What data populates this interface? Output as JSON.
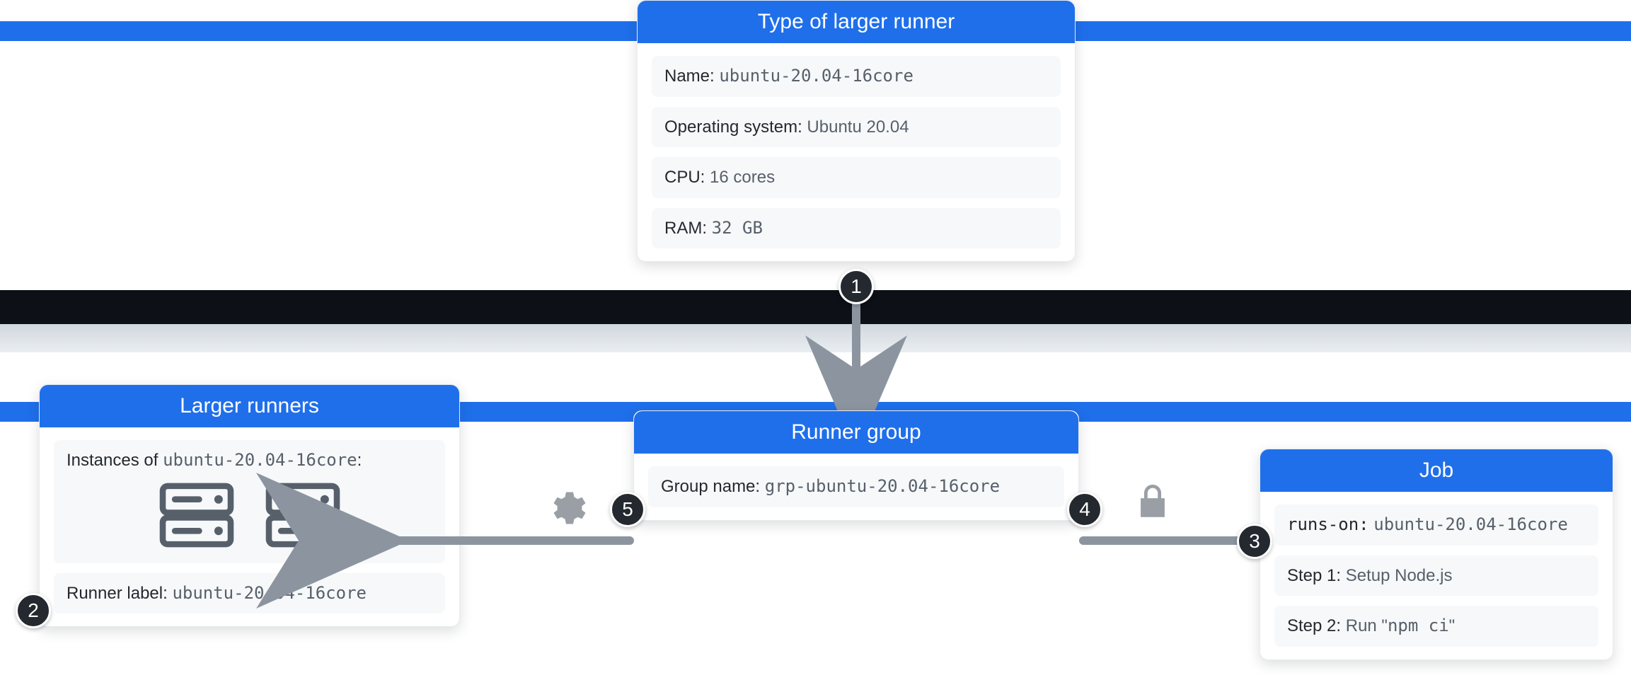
{
  "bars": {
    "top": true,
    "mid": true
  },
  "typeCard": {
    "title": "Type of larger runner",
    "nameLabel": "Name:",
    "nameValue": "ubuntu-20.04-16core",
    "osLabel": "Operating system:",
    "osValue": "Ubuntu 20.04",
    "cpuLabel": "CPU:",
    "cpuValue": "16 cores",
    "ramLabel": "RAM:",
    "ramValue": "32 GB"
  },
  "runnersCard": {
    "title": "Larger runners",
    "instancesLabel": "Instances of",
    "instancesValue": "ubuntu-20.04-16core",
    "instancesSuffix": ":",
    "runnerLabelLabel": "Runner label:",
    "runnerLabelValue": "ubuntu-20.04-16core"
  },
  "groupCard": {
    "title": "Runner group",
    "groupNameLabel": "Group name:",
    "groupNameValue": "grp-ubuntu-20.04-16core"
  },
  "jobCard": {
    "title": "Job",
    "runsOnLabel": "runs-on:",
    "runsOnValue": "ubuntu-20.04-16core",
    "step1Label": "Step 1:",
    "step1Value": "Setup Node.js",
    "step2Label": "Step 2:",
    "step2ValuePre": "Run \"",
    "step2ValueMono": "npm ci",
    "step2ValuePost": "\""
  },
  "badges": {
    "b1": "1",
    "b2": "2",
    "b3": "3",
    "b4": "4",
    "b5": "5"
  }
}
